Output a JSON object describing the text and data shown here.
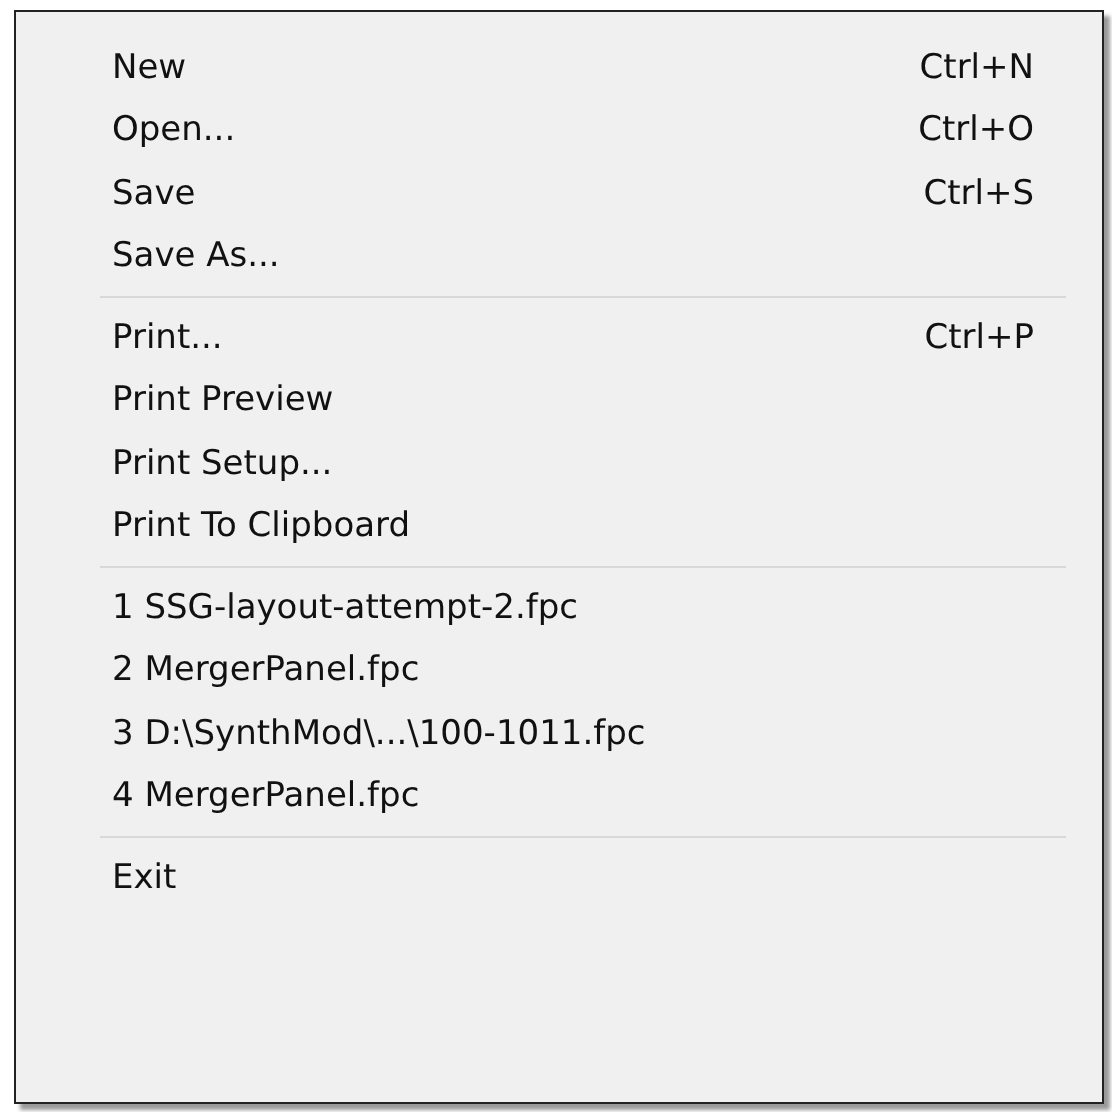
{
  "menu": {
    "groups": [
      {
        "items": [
          {
            "label": "New",
            "shortcut": "Ctrl+N"
          },
          {
            "label": "Open...",
            "shortcut": "Ctrl+O"
          },
          {
            "label": "Save",
            "shortcut": "Ctrl+S"
          },
          {
            "label": "Save As..."
          }
        ]
      },
      {
        "items": [
          {
            "label": "Print...",
            "shortcut": "Ctrl+P"
          },
          {
            "label": "Print Preview"
          },
          {
            "label": "Print Setup..."
          },
          {
            "label": "Print To Clipboard"
          }
        ]
      },
      {
        "items": [
          {
            "label": "1 SSG-layout-attempt-2.fpc"
          },
          {
            "label": "2 MergerPanel.fpc"
          },
          {
            "label": "3 D:\\SynthMod\\...\\100-1011.fpc"
          },
          {
            "label": "4 MergerPanel.fpc"
          }
        ]
      },
      {
        "items": [
          {
            "label": "Exit"
          }
        ]
      }
    ]
  }
}
